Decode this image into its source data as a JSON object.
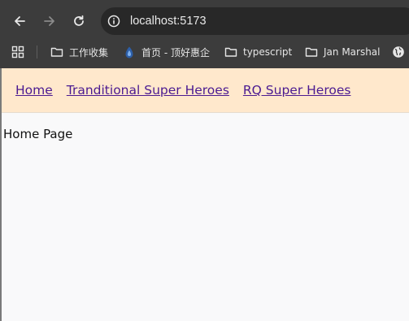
{
  "browser": {
    "url": "localhost:5173",
    "bookmarks": [
      {
        "label": "工作收集",
        "icon": "folder-icon"
      },
      {
        "label": "首页 - 顶好惠企",
        "icon": "site-favicon-icon"
      },
      {
        "label": "typescript",
        "icon": "folder-icon"
      },
      {
        "label": "Jan Marshal",
        "icon": "folder-icon"
      }
    ]
  },
  "app": {
    "nav": [
      {
        "label": "Home"
      },
      {
        "label": "Tranditional Super Heroes"
      },
      {
        "label": "RQ Super Heroes"
      }
    ],
    "page_text": "Home Page"
  },
  "colors": {
    "browser_chrome": "#3c3c3c",
    "omnibox_bg": "#282828",
    "header_bg": "#ffe8cc",
    "link": "#4b1a91",
    "page_bg": "#f9f9fa"
  }
}
